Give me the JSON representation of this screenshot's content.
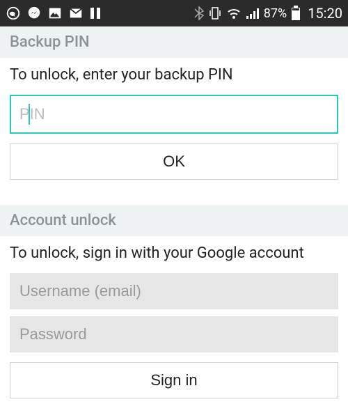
{
  "status_bar": {
    "battery_pct": "87%",
    "time": "15:20"
  },
  "backup_pin": {
    "header": "Backup PIN",
    "instruction": "To unlock, enter your backup PIN",
    "placeholder": "PIN",
    "ok_label": "OK"
  },
  "account_unlock": {
    "header": "Account unlock",
    "instruction": "To unlock, sign in with your Google account",
    "username_placeholder": "Username (email)",
    "password_placeholder": "Password",
    "signin_label": "Sign in"
  }
}
